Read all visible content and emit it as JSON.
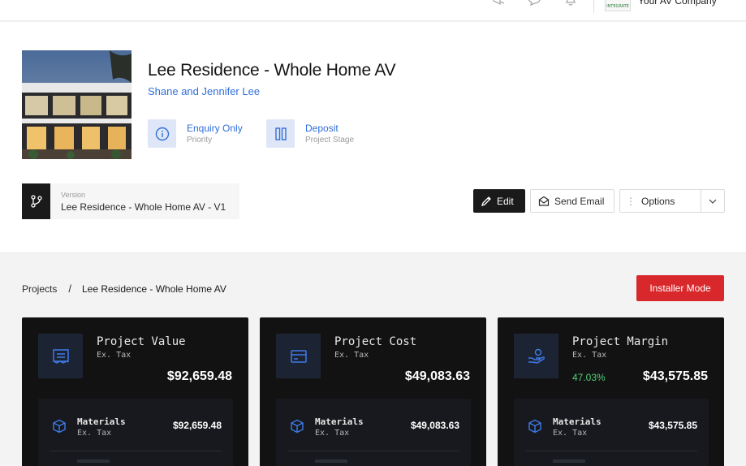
{
  "topbar": {
    "company_name": "Your AV Company",
    "company_logo_text": "INTEGRATE"
  },
  "project": {
    "title": "Lee Residence - Whole Home AV",
    "client": "Shane and Jennifer Lee",
    "priority": {
      "value": "Enquiry Only",
      "label": "Priority"
    },
    "stage": {
      "value": "Deposit",
      "label": "Project Stage"
    },
    "version": {
      "label": "Version",
      "value": "Lee Residence - Whole Home AV - V1"
    }
  },
  "actions": {
    "edit_label": "Edit",
    "email_label": "Send Email",
    "options_label": "Options"
  },
  "breadcrumb": {
    "root": "Projects",
    "separator": "/",
    "current": "Lee Residence - Whole Home AV"
  },
  "installer_mode_label": "Installer Mode",
  "cards": [
    {
      "title": "Project Value",
      "subtitle": "Ex. Tax",
      "value": "$92,659.48",
      "icon": "document-icon",
      "materials": {
        "title": "Materials",
        "subtitle": "Ex. Tax",
        "value": "$92,659.48"
      }
    },
    {
      "title": "Project Cost",
      "subtitle": "Ex. Tax",
      "value": "$49,083.63",
      "icon": "card-icon",
      "materials": {
        "title": "Materials",
        "subtitle": "Ex. Tax",
        "value": "$49,083.63"
      }
    },
    {
      "title": "Project Margin",
      "subtitle": "Ex. Tax",
      "value": "$43,575.85",
      "percentage": "47.03%",
      "icon": "hand-coin-icon",
      "materials": {
        "title": "Materials",
        "subtitle": "Ex. Tax",
        "value": "$43,575.85"
      }
    }
  ],
  "colors": {
    "accent_blue": "#2f6fd8",
    "danger_red": "#d8282c",
    "card_bg": "#121212",
    "margin_green": "#4fd07a"
  }
}
